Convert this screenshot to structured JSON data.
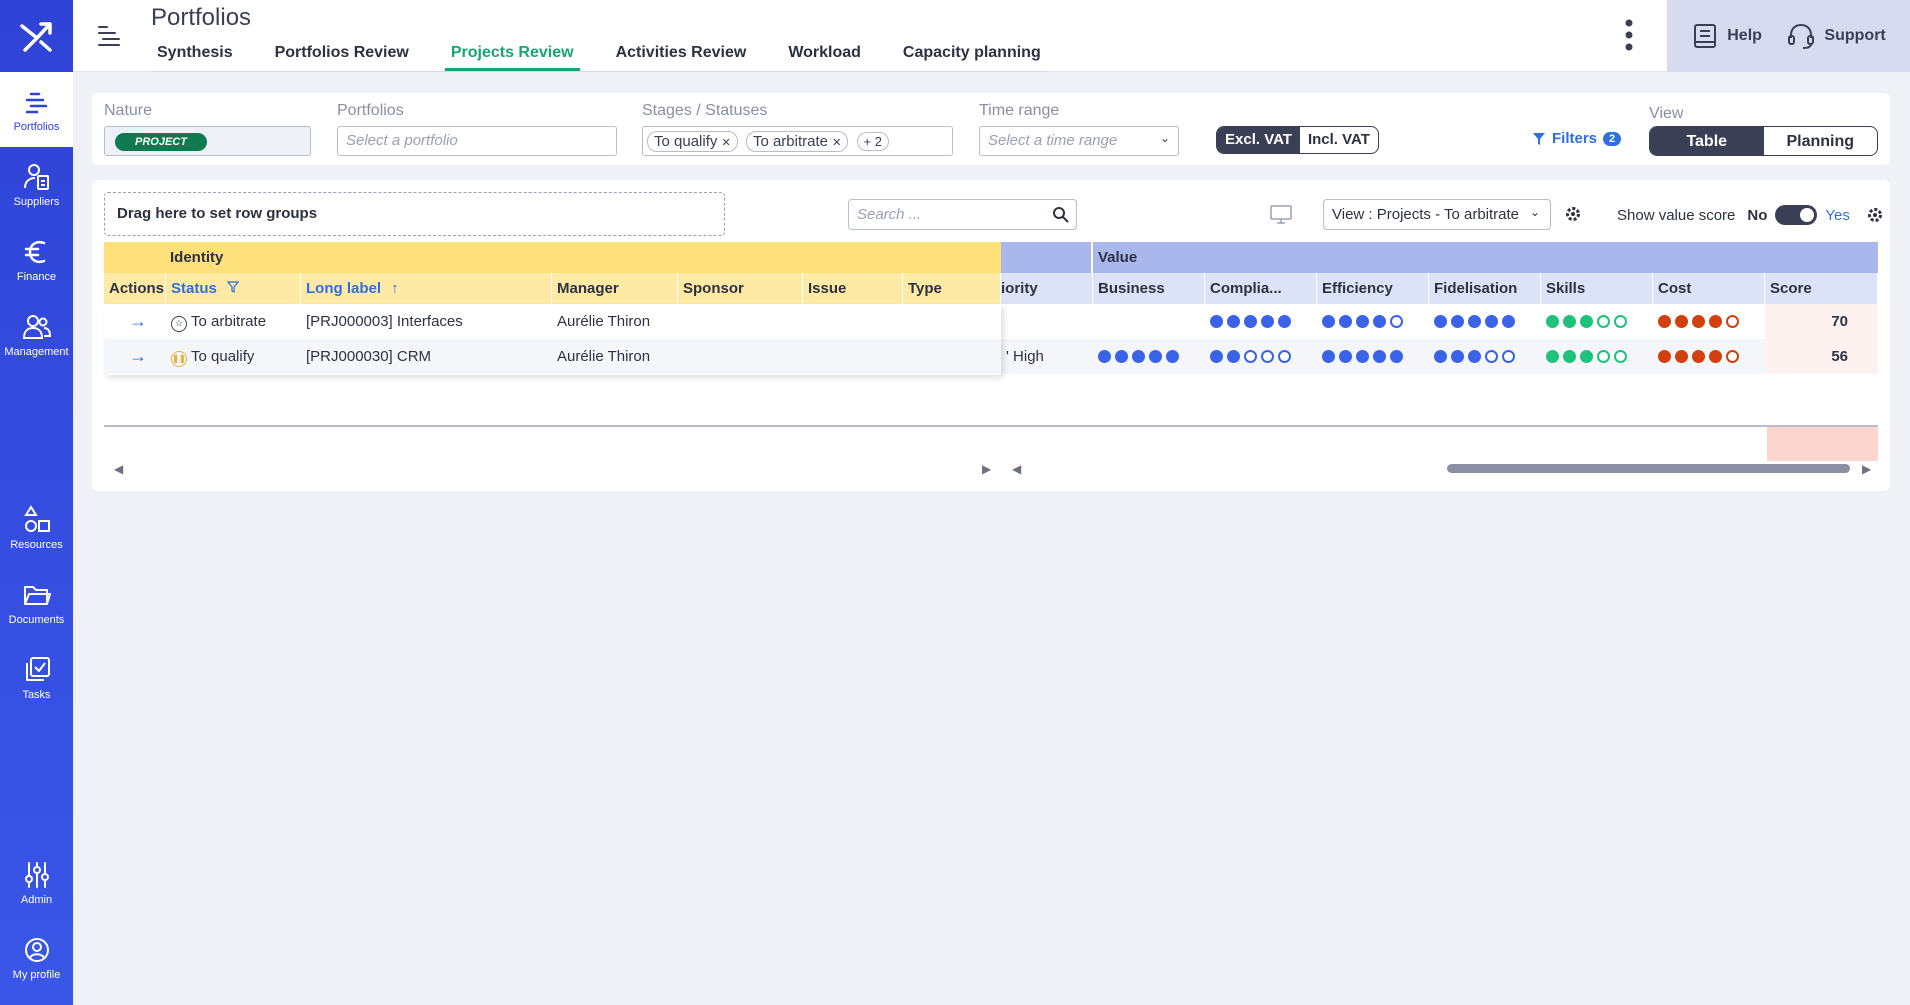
{
  "sidebar": {
    "items_top": [
      {
        "label": "Portfolios",
        "icon": "portfolios-icon"
      },
      {
        "label": "Suppliers",
        "icon": "suppliers-icon"
      },
      {
        "label": "Finance",
        "icon": "euro-icon"
      },
      {
        "label": "Management",
        "icon": "management-icon"
      }
    ],
    "items_mid": [
      {
        "label": "Resources",
        "icon": "shapes-icon"
      },
      {
        "label": "Documents",
        "icon": "folder-icon"
      },
      {
        "label": "Tasks",
        "icon": "tasks-icon"
      }
    ],
    "items_bottom": [
      {
        "label": "Admin",
        "icon": "sliders-icon"
      },
      {
        "label": "My profile",
        "icon": "profile-icon"
      }
    ]
  },
  "header": {
    "title": "Portfolios",
    "tabs": [
      "Synthesis",
      "Portfolios Review",
      "Projects Review",
      "Activities Review",
      "Workload",
      "Capacity planning"
    ],
    "active_tab": "Projects Review",
    "help_label": "Help",
    "support_label": "Support"
  },
  "filters": {
    "nature_label": "Nature",
    "nature_value": "PROJECT",
    "portfolios_label": "Portfolios",
    "portfolios_placeholder": "Select a portfolio",
    "stages_label": "Stages / Statuses",
    "stage_chips": [
      "To qualify",
      "To arbitrate"
    ],
    "stage_more": "+ 2",
    "time_label": "Time range",
    "time_placeholder": "Select a time range",
    "vat_excl": "Excl. VAT",
    "vat_incl": "Incl. VAT",
    "filters_label": "Filters",
    "filters_count": "2",
    "view_label": "View",
    "view_table": "Table",
    "view_planning": "Planning"
  },
  "toolbar": {
    "group_zone": "Drag here to set row groups",
    "search_placeholder": "Search ...",
    "view_select": "View : Projects - To arbitrate",
    "show_value_score": "Show value score",
    "no": "No",
    "yes": "Yes"
  },
  "grid": {
    "group_identity": "Identity",
    "group_value": "Value",
    "columns_identity": [
      "Actions",
      "Status",
      "Long label",
      "Manager",
      "Sponsor",
      "Issue",
      "Type"
    ],
    "col_priority": "iority",
    "columns_value": [
      "Business",
      "Complia...",
      "Efficiency",
      "Fidelisation",
      "Skills",
      "Cost",
      "Score"
    ],
    "rows": [
      {
        "status": "To arbitrate",
        "label": "[PRJ000003] Interfaces",
        "manager": "Aurélie Thiron",
        "priority": "",
        "business": null,
        "compliance": 5,
        "efficiency": 4,
        "fidelisation": 5,
        "skills": 3,
        "cost": 4,
        "score": "70"
      },
      {
        "status": "To qualify",
        "label": "[PRJ000030] CRM",
        "manager": "Aurélie Thiron",
        "priority": "High",
        "business": 5,
        "compliance": 2,
        "efficiency": 5,
        "fidelisation": 3,
        "skills": 3,
        "cost": 4,
        "score": "56"
      }
    ]
  },
  "colors": {
    "accent_green": "#17a673",
    "blue_dot": "#3b63e8",
    "green_dot": "#1ec27a",
    "red_dot": "#d0410f"
  }
}
